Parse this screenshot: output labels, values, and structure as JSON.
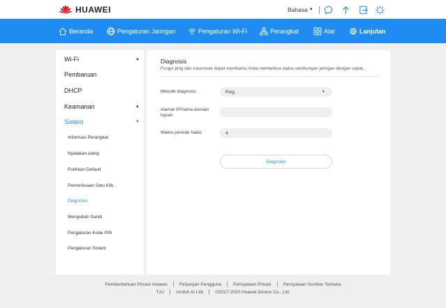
{
  "brand": {
    "name": "HUAWEI",
    "color": "#e60012"
  },
  "header": {
    "language_label": "Bahasa",
    "icons": [
      "chat-icon",
      "upload-arrow-icon",
      "exit-icon",
      "loading-icon"
    ]
  },
  "nav": {
    "accent": "#1e8cf0",
    "items": [
      {
        "label": "Beranda",
        "icon": "home-icon"
      },
      {
        "label": "Pengaturan Jaringan",
        "icon": "globe-icon"
      },
      {
        "label": "Pengaturan Wi-Fi",
        "icon": "wifi-icon"
      },
      {
        "label": "Perangkat",
        "icon": "devices-icon"
      },
      {
        "label": "Alat",
        "icon": "grid-icon"
      },
      {
        "label": "Lanjutan",
        "icon": "gear-icon",
        "active": true
      }
    ]
  },
  "sidebar": {
    "items": [
      {
        "label": "Wi-Fi",
        "expanded": true
      },
      {
        "label": "Pembaruan"
      },
      {
        "label": "DHCP"
      },
      {
        "label": "Keamanan",
        "expanded": true
      },
      {
        "label": "Sistem",
        "expanded": true,
        "selected": true
      }
    ],
    "subitems": [
      {
        "label": "Informasi Perangkat"
      },
      {
        "label": "Nyalakan ulang"
      },
      {
        "label": "Pulihkan Default"
      },
      {
        "label": "Pemeriksaan Satu Klik"
      },
      {
        "label": "Diagnosis",
        "active": true
      },
      {
        "label": "Mengubah Sandi"
      },
      {
        "label": "Pengaturan Kode PIN"
      },
      {
        "label": "Pengaturan Sistem"
      }
    ]
  },
  "main": {
    "title": "Diagnosis",
    "description": "Fungsi ping dan traceroute dapat membantu Anda memeriksa status sambungan jaringan dengan cepat.",
    "fields": {
      "method": {
        "label": "Metode diagnosis",
        "value": "Ping"
      },
      "address": {
        "label": "Alamat IP/nama domain tujuan",
        "value": ""
      },
      "timeout": {
        "label": "Waktu periode habis",
        "value": "4"
      }
    },
    "button_label": "Diagnosis"
  },
  "footer": {
    "row1": [
      "Pemberitahuan Privasi Huawei",
      "Perjanjian Pengguna",
      "Pernyataan Privasi",
      "Pernyataan Sumber Terbuka"
    ],
    "row2": [
      "TJU",
      "Unduh AI Life",
      "©2017-2020 Huawei Device Co., Ltd."
    ]
  }
}
